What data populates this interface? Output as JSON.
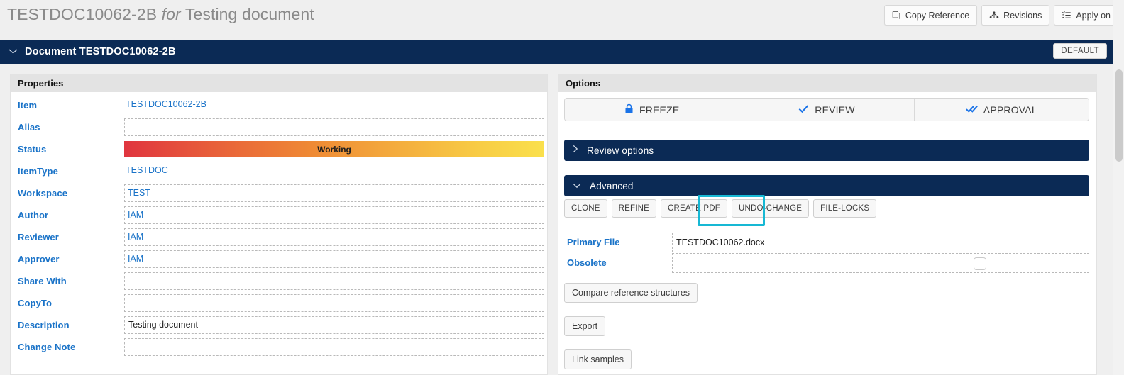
{
  "header": {
    "title_id": "TESTDOC10062-2B",
    "title_for": "for",
    "title_name": "Testing document",
    "buttons": [
      {
        "label": "Copy Reference",
        "icon": "copy-icon"
      },
      {
        "label": "Revisions",
        "icon": "branch-icon"
      },
      {
        "label": "Apply on",
        "icon": "list-icon"
      }
    ]
  },
  "document_bar": {
    "title": "Document TESTDOC10062-2B",
    "chevron": "chevron-down-icon",
    "badge": "DEFAULT"
  },
  "properties": {
    "panel_title": "Properties",
    "rows": [
      {
        "label": "Item",
        "value": "TESTDOC10062-2B",
        "style": "link-nodash"
      },
      {
        "label": "Alias",
        "value": "",
        "style": "dashed"
      },
      {
        "label": "Status",
        "value": "Working",
        "style": "status"
      },
      {
        "label": "ItemType",
        "value": "TESTDOC",
        "style": "link-nodash"
      },
      {
        "label": "Workspace",
        "value": "TEST",
        "style": "dashed-link"
      },
      {
        "label": "Author",
        "value": "IAM",
        "style": "dashed-link"
      },
      {
        "label": "Reviewer",
        "value": "IAM",
        "style": "dashed-link"
      },
      {
        "label": "Approver",
        "value": "IAM",
        "style": "dashed-link"
      },
      {
        "label": "Share With",
        "value": "",
        "style": "dashed"
      },
      {
        "label": "CopyTo",
        "value": "",
        "style": "dashed"
      },
      {
        "label": "Description",
        "value": "Testing document",
        "style": "dashed-plain"
      },
      {
        "label": "Change Note",
        "value": "",
        "style": "dashed"
      }
    ]
  },
  "options": {
    "panel_title": "Options",
    "segments": [
      {
        "label": "FREEZE",
        "icon": "lock-icon"
      },
      {
        "label": "REVIEW",
        "icon": "check-icon"
      },
      {
        "label": "APPROVAL",
        "icon": "double-check-icon"
      }
    ],
    "review_accordion": {
      "label": "Review options",
      "chevron": "chevron-right-icon",
      "expanded": false
    },
    "advanced_accordion": {
      "label": "Advanced",
      "chevron": "chevron-down-icon",
      "expanded": true
    },
    "advanced": {
      "buttons": [
        "CLONE",
        "REFINE",
        "CREATE PDF",
        "UNDO-CHANGE",
        "FILE-LOCKS"
      ],
      "highlighted_button": "UNDO-CHANGE",
      "highlight_color": "#17b8d4",
      "fields": [
        {
          "label": "Primary File",
          "value": "TESTDOC10062.docx",
          "type": "text"
        },
        {
          "label": "Obsolete",
          "value": "",
          "type": "checkbox",
          "checked": false
        }
      ],
      "wide_buttons": [
        "Compare reference structures",
        "Export",
        "Link samples"
      ]
    }
  },
  "colors": {
    "header_blue": "#0b2a55",
    "label_blue": "#1a73c8",
    "accent_cyan": "#17b8d4",
    "status_from": "#e0353f",
    "status_to": "#fae04c"
  }
}
